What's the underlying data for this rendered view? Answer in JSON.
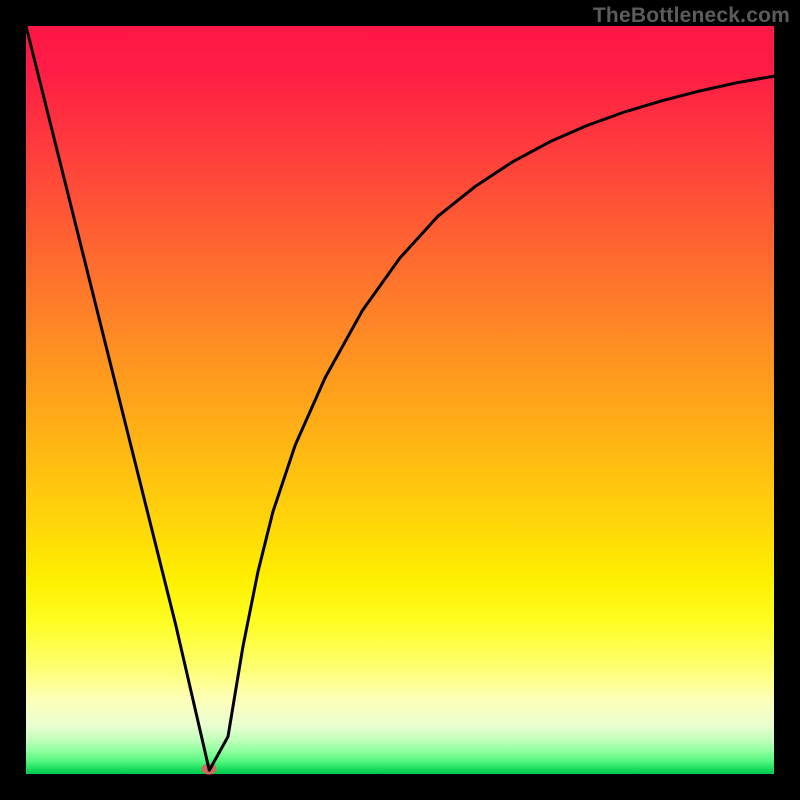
{
  "watermark": "TheBottleneck.com",
  "colors": {
    "curve_stroke": "#000000",
    "marker_fill": "#cf6a62",
    "frame": "#000000"
  },
  "chart_data": {
    "type": "line",
    "title": "",
    "xlabel": "",
    "ylabel": "",
    "xlim": [
      0,
      100
    ],
    "ylim": [
      0,
      100
    ],
    "grid": false,
    "legend": false,
    "series": [
      {
        "name": "bottleneck-curve",
        "x": [
          0,
          5,
          10,
          15,
          20,
          24.5,
          27,
          29,
          31,
          33,
          36,
          40,
          45,
          50,
          55,
          60,
          65,
          70,
          75,
          80,
          85,
          90,
          95,
          100
        ],
        "values": [
          100,
          80,
          60,
          40,
          20,
          0.5,
          5,
          17,
          27,
          35,
          44,
          53,
          62,
          69,
          74.5,
          78.5,
          81.8,
          84.5,
          86.7,
          88.5,
          90,
          91.3,
          92.4,
          93.3
        ]
      }
    ],
    "annotations": [
      {
        "name": "minimum-marker",
        "x": 24.5,
        "y": 0.6
      }
    ],
    "background_gradient": {
      "type": "vertical",
      "stops": [
        {
          "pos": 0,
          "color": "#ff1745"
        },
        {
          "pos": 50,
          "color": "#ffa31a"
        },
        {
          "pos": 78,
          "color": "#fff400"
        },
        {
          "pos": 100,
          "color": "#00c94d"
        }
      ]
    }
  }
}
